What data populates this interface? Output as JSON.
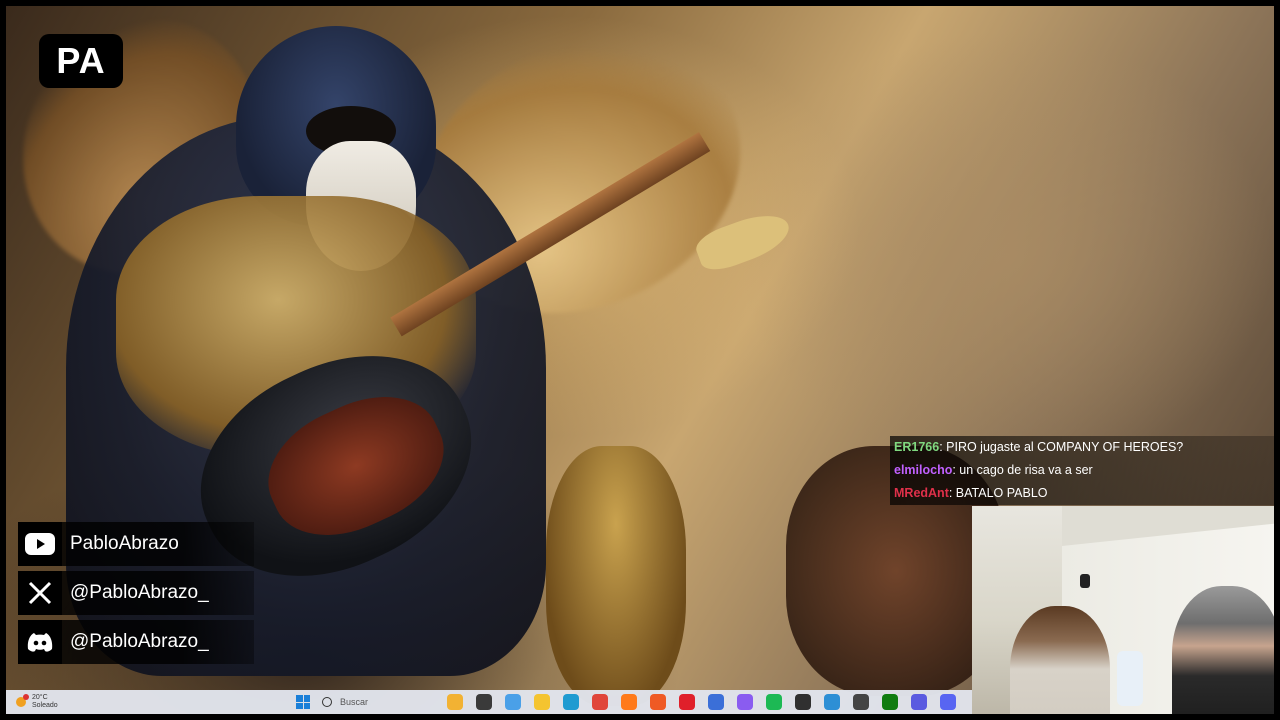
{
  "overlay": {
    "logo_text": "PA"
  },
  "socials": [
    {
      "icon": "youtube-icon",
      "handle": "PabloAbrazo"
    },
    {
      "icon": "x-icon",
      "handle": "@PabloAbrazo_"
    },
    {
      "icon": "discord-icon",
      "handle": "@PabloAbrazo_"
    }
  ],
  "chat": [
    {
      "user": "ER1766",
      "message": ": PIRO jugaste al COMPANY OF HEROES?",
      "color": "#7fd87f"
    },
    {
      "user": "elmilocho",
      "message": ": un cago de risa va a ser",
      "color": "#c060ff"
    },
    {
      "user": "MRedAnt",
      "message": ": BATALO PABLO",
      "color": "#e0304a"
    }
  ],
  "taskbar": {
    "weather_temp": "20°C",
    "weather_desc": "Soleado",
    "search_placeholder": "Buscar",
    "apps": [
      {
        "name": "widgets-app",
        "color": "#f2b233"
      },
      {
        "name": "file-app",
        "color": "#3a3a3a"
      },
      {
        "name": "copilot-app",
        "color": "#4aa0e8"
      },
      {
        "name": "explorer-app",
        "color": "#f4c430"
      },
      {
        "name": "edge-app",
        "color": "#1f9bd1"
      },
      {
        "name": "chrome-app",
        "color": "#e0453a"
      },
      {
        "name": "firefox-app",
        "color": "#ff7a1a"
      },
      {
        "name": "brave-app",
        "color": "#ef5a24"
      },
      {
        "name": "opera-app",
        "color": "#e0202a"
      },
      {
        "name": "mail-app",
        "color": "#3b6fd8"
      },
      {
        "name": "snip-app",
        "color": "#8a5cf0"
      },
      {
        "name": "spotify-app",
        "color": "#1db954"
      },
      {
        "name": "obs-app",
        "color": "#303030"
      },
      {
        "name": "vscode-app",
        "color": "#2d8fd5"
      },
      {
        "name": "audio-app",
        "color": "#444444"
      },
      {
        "name": "xbox-app",
        "color": "#107c10"
      },
      {
        "name": "gamepad-app",
        "color": "#5a5ae0"
      },
      {
        "name": "discord-app",
        "color": "#5865f2"
      }
    ]
  }
}
